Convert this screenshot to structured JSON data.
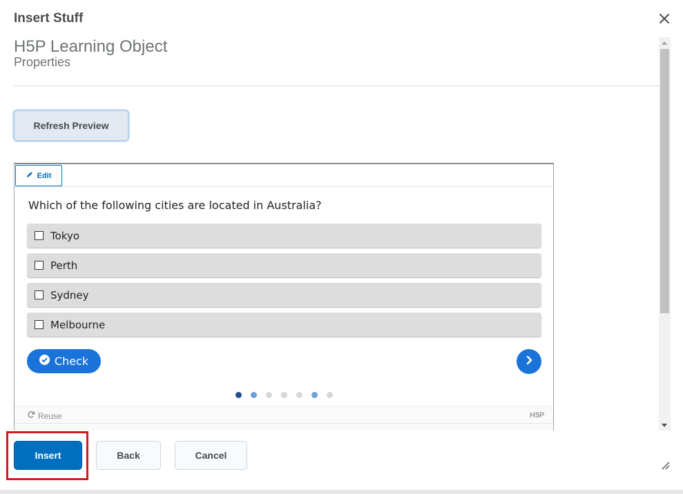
{
  "dialog": {
    "title": "Insert Stuff",
    "close_icon": "close-icon"
  },
  "content": {
    "heading": "H5P Learning Object",
    "subheading": "Properties",
    "refresh_label": "Refresh Preview"
  },
  "preview": {
    "edit_label": "Edit",
    "question": "Which of the following cities are located in Australia?",
    "options": [
      {
        "label": "Tokyo",
        "checked": false
      },
      {
        "label": "Perth",
        "checked": false
      },
      {
        "label": "Sydney",
        "checked": false
      },
      {
        "label": "Melbourne",
        "checked": false
      }
    ],
    "check_label": "Check",
    "reuse_label": "Reuse",
    "brand": "H5P",
    "pager": {
      "total": 7,
      "current": 1,
      "dot_colors": [
        "#1f4e8c",
        "#6d9fd4",
        "#d8d8d8",
        "#d8d8d8",
        "#d8d8d8",
        "#6d9fd4",
        "#d8d8d8"
      ]
    }
  },
  "actions": {
    "insert_label": "Insert",
    "back_label": "Back",
    "cancel_label": "Cancel"
  },
  "colors": {
    "primary": "#006fbf",
    "h5p_blue": "#1a73d9",
    "highlight": "#d6171b"
  }
}
